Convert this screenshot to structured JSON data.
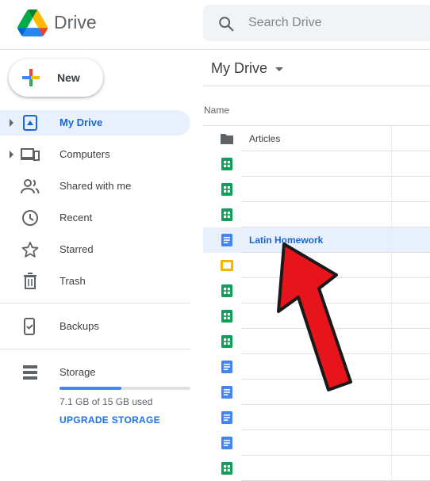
{
  "header": {
    "app_name": "Drive",
    "search_placeholder": "Search Drive"
  },
  "sidebar": {
    "new_label": "New",
    "items": [
      {
        "label": "My Drive",
        "icon": "my-drive-icon",
        "active": true,
        "expandable": true
      },
      {
        "label": "Computers",
        "icon": "computers-icon",
        "active": false,
        "expandable": true
      },
      {
        "label": "Shared with me",
        "icon": "shared-icon",
        "active": false
      },
      {
        "label": "Recent",
        "icon": "clock-icon",
        "active": false
      },
      {
        "label": "Starred",
        "icon": "star-icon",
        "active": false
      },
      {
        "label": "Trash",
        "icon": "trash-icon",
        "active": false
      },
      {
        "label": "Backups",
        "icon": "backups-icon",
        "active": false
      },
      {
        "label": "Storage",
        "icon": "storage-icon",
        "active": false
      }
    ],
    "storage": {
      "used_text": "7.1 GB of 15 GB used",
      "used_fraction": 0.473,
      "upgrade_label": "UPGRADE STORAGE"
    }
  },
  "main": {
    "breadcrumb": "My Drive",
    "column_name": "Name",
    "files": [
      {
        "name": "Articles",
        "type": "folder"
      },
      {
        "name": "",
        "type": "sheet"
      },
      {
        "name": "",
        "type": "sheet"
      },
      {
        "name": "",
        "type": "sheet"
      },
      {
        "name": "Latin Homework",
        "type": "doc",
        "selected": true
      },
      {
        "name": "",
        "type": "slide"
      },
      {
        "name": "",
        "type": "sheet"
      },
      {
        "name": "",
        "type": "sheet"
      },
      {
        "name": "",
        "type": "sheet"
      },
      {
        "name": "",
        "type": "doc"
      },
      {
        "name": "",
        "type": "doc"
      },
      {
        "name": "",
        "type": "doc"
      },
      {
        "name": "",
        "type": "doc"
      },
      {
        "name": "",
        "type": "sheet"
      }
    ]
  },
  "colors": {
    "accent": "#1a73e8",
    "sheet": "#0f9d58",
    "doc": "#4285f4",
    "slide": "#f4b400",
    "folder": "#5f6368",
    "annotation_arrow": "#e8141b"
  }
}
